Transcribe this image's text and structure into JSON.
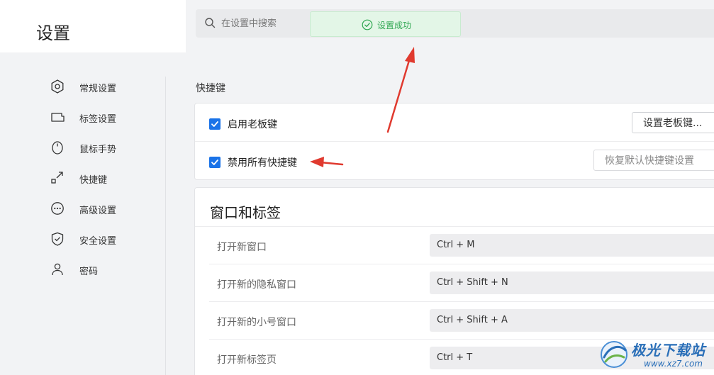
{
  "header": {
    "title": "设置",
    "search_placeholder": "在设置中搜索"
  },
  "toast": {
    "message": "设置成功",
    "color": "#2ea650"
  },
  "sidebar": {
    "items": [
      {
        "label": "常规设置",
        "icon": "hexagon-settings-icon"
      },
      {
        "label": "标签设置",
        "icon": "tab-icon"
      },
      {
        "label": "鼠标手势",
        "icon": "mouse-icon"
      },
      {
        "label": "快捷键",
        "icon": "shortcut-arrow-icon"
      },
      {
        "label": "高级设置",
        "icon": "more-dots-icon"
      },
      {
        "label": "安全设置",
        "icon": "shield-icon"
      },
      {
        "label": "密码",
        "icon": "user-icon"
      }
    ]
  },
  "shortcuts": {
    "section_label": "快捷键",
    "boss_key": {
      "label": "启用老板键",
      "checked": true,
      "button": "设置老板键..."
    },
    "disable_all": {
      "label": "禁用所有快捷键",
      "checked": true,
      "button": "恢复默认快捷键设置"
    }
  },
  "window_tabs": {
    "title": "窗口和标签",
    "rows": [
      {
        "label": "打开新窗口",
        "value": "Ctrl + M"
      },
      {
        "label": "打开新的隐私窗口",
        "value": "Ctrl + Shift + N"
      },
      {
        "label": "打开新的小号窗口",
        "value": "Ctrl + Shift + A"
      },
      {
        "label": "打开新标签页",
        "value": "Ctrl + T"
      }
    ]
  },
  "watermark": {
    "name": "极光下载站",
    "url": "www.xz7.com"
  },
  "colors": {
    "accent": "#1a73e8",
    "annotation_arrow": "#e03a2f"
  }
}
